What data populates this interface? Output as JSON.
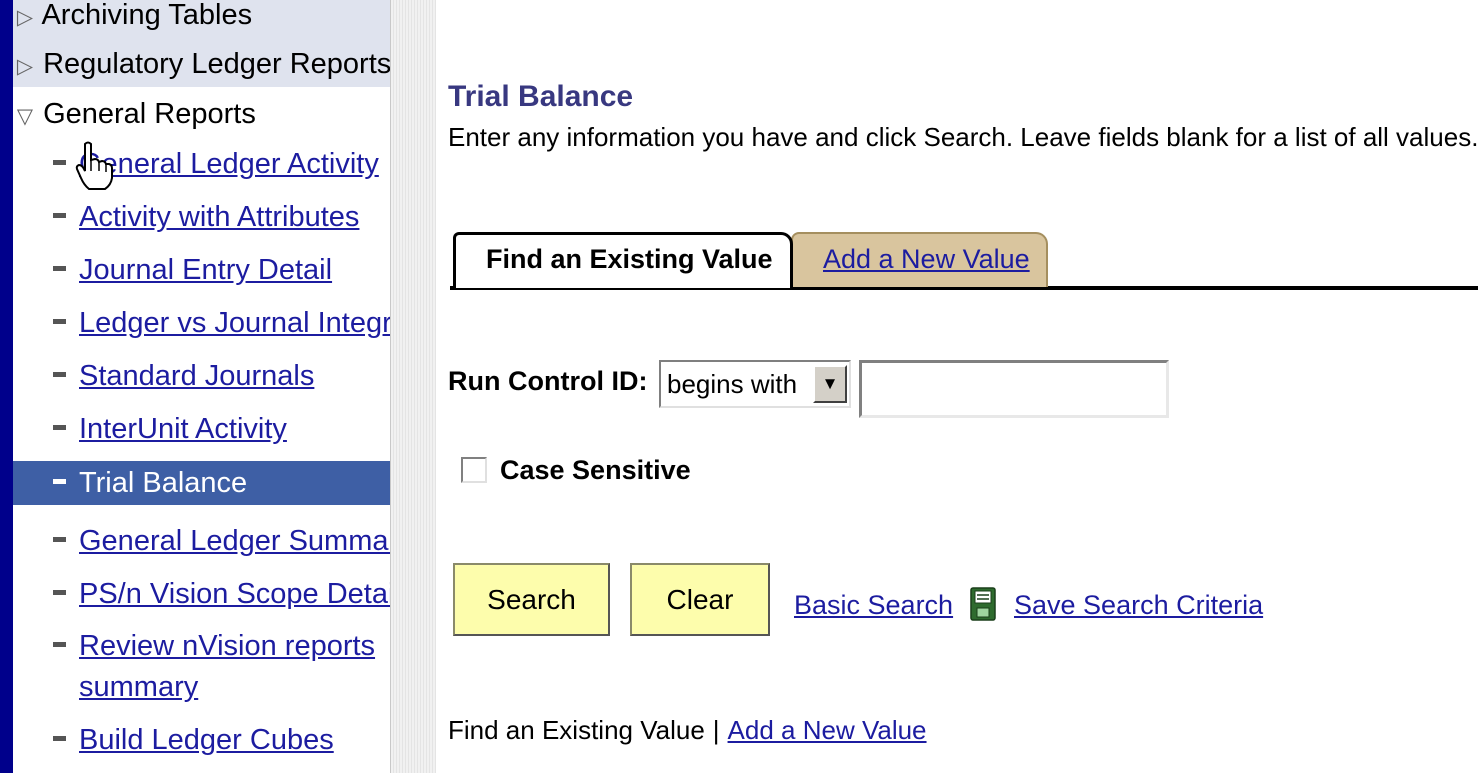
{
  "nav": {
    "items": [
      {
        "label": "Archiving Tables",
        "type": "collapsed"
      },
      {
        "label": "Regulatory Ledger Reports",
        "type": "collapsed"
      },
      {
        "label": "General Reports",
        "type": "expanded"
      },
      {
        "label": "General Ledger Activity",
        "type": "link"
      },
      {
        "label": "Activity with Attributes",
        "type": "link"
      },
      {
        "label": "Journal Entry Detail",
        "type": "link"
      },
      {
        "label": "Ledger vs Journal Integrity",
        "type": "link"
      },
      {
        "label": "Standard Journals",
        "type": "link"
      },
      {
        "label": "InterUnit Activity",
        "type": "link"
      },
      {
        "label": "Trial Balance",
        "type": "selected"
      },
      {
        "label": "General Ledger Summary",
        "type": "link"
      },
      {
        "label": "PS/n Vision Scope Details",
        "type": "link"
      },
      {
        "label": "Review nVision reports",
        "type": "link"
      },
      {
        "label": "summary",
        "type": "link-continued"
      },
      {
        "label": "Build Ledger Cubes",
        "type": "link"
      }
    ]
  },
  "page": {
    "title": "Trial Balance",
    "instructions": "Enter any information you have and click Search. Leave fields blank for a list of all values."
  },
  "tabs": {
    "find_label": "Find an Existing Value",
    "add_label": "Add a New Value"
  },
  "search_form": {
    "run_control_label": "Run Control ID:",
    "operator_value": "begins with",
    "run_control_value": "",
    "case_sensitive_label": "Case Sensitive",
    "case_sensitive_checked": false
  },
  "buttons": {
    "search_label": "Search",
    "clear_label": "Clear",
    "basic_search_label": "Basic Search",
    "save_search_criteria_label": "Save Search Criteria"
  },
  "footer_links": {
    "find_label": "Find an Existing Value",
    "separator": "|",
    "add_label": "Add a New Value"
  },
  "colors": {
    "outer_border": "#00008b",
    "nav_selected_bg": "#3e5fa5",
    "link": "#1c1ca0",
    "button_bg": "#fdfdac",
    "add_tab_bg": "#d9c59e",
    "title": "#383880"
  },
  "icons": {
    "collapsed_marker": "triangle-right-icon",
    "expanded_marker": "triangle-down-icon",
    "item_marker": "dash-bullet-icon",
    "save_criteria": "floppy-disk-icon",
    "dropdown": "chevron-down-icon",
    "cursor": "hand-pointer-icon"
  }
}
